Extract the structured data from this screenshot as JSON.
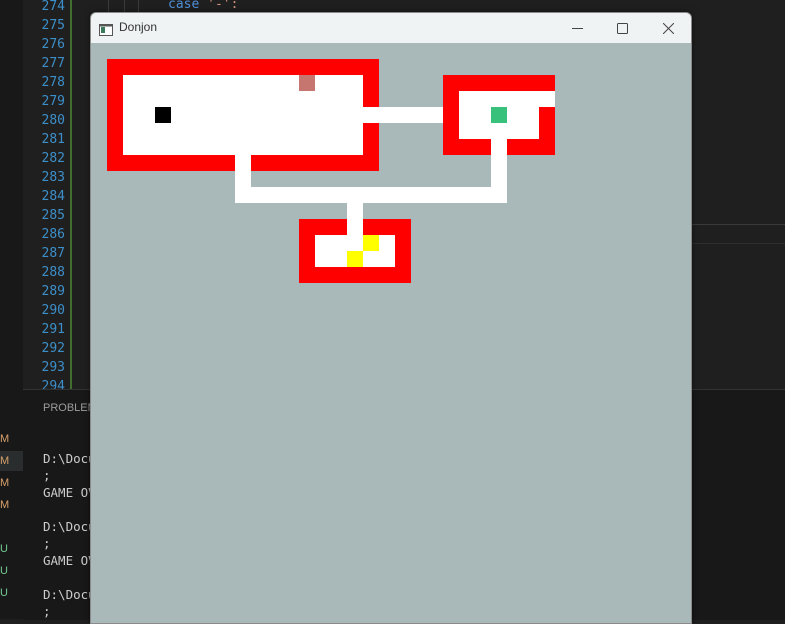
{
  "editor": {
    "line_numbers": [
      "274",
      "275",
      "276",
      "277",
      "278",
      "279",
      "280",
      "281",
      "282",
      "283",
      "284",
      "285",
      "286",
      "287",
      "288",
      "289",
      "290",
      "291",
      "292",
      "293",
      "294"
    ],
    "code_keyword": "case",
    "code_string": "'-':"
  },
  "panel": {
    "tab_label": "PROBLEM",
    "terminal_lines": [
      "D:\\Docu",
      ";",
      "GAME OV",
      "D:\\Docu",
      ";",
      "GAME OV",
      "D:\\Docu",
      ";"
    ]
  },
  "scm_markers": [
    "M",
    "M",
    "M",
    "M",
    "U",
    "U",
    "U"
  ],
  "window": {
    "title": "Donjon",
    "minimize_icon": "minimize-icon",
    "maximize_icon": "maximize-icon",
    "close_icon": "close-icon"
  },
  "game": {
    "colors": {
      "background": "#a9b9b9",
      "wall": "#ff0000",
      "floor": "#ffffff",
      "player": "#000000",
      "monster": "#c6766e",
      "exit": "#38c17a",
      "gold": "#ffff00"
    },
    "entities": [
      "player",
      "monster",
      "exit",
      "gold",
      "gold"
    ]
  }
}
